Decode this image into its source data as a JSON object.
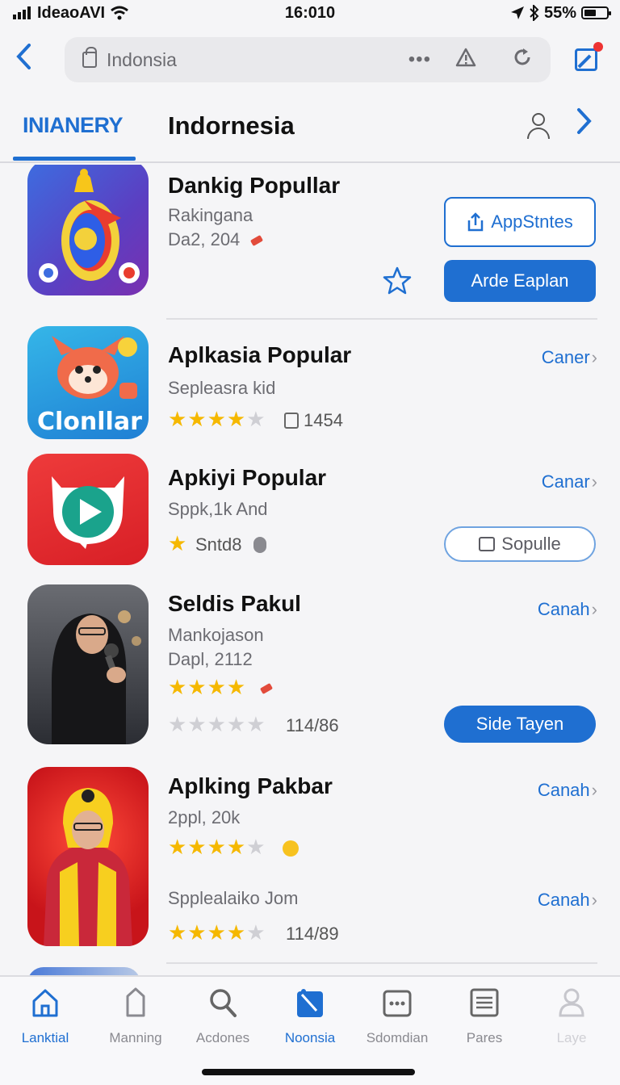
{
  "status_bar": {
    "carrier": "IdeaoAVI",
    "time": "16:010",
    "battery": "55%"
  },
  "url_bar": {
    "text": "Indonsia",
    "more_icon": "ellipsis-icon",
    "warning_icon": "warning-icon",
    "reload_icon": "reload-icon"
  },
  "header": {
    "active_tab": "INIANERY",
    "title": "Indornesia"
  },
  "apps": [
    {
      "title": "Dankig Popullar",
      "subtitle": "Rakingana",
      "date": "Da2, 204",
      "outline_button": "AppStntes",
      "solid_button": "Arde Eaplan"
    },
    {
      "title": "Aplkasia Popular",
      "subtitle": "Sepleasra kid",
      "rating_stars": 4,
      "count": "1454",
      "action": "Caner"
    },
    {
      "title": "Apkiyi Popular",
      "subtitle": "Sppk,1k And",
      "rating_stars": 1,
      "count": "Sntd8",
      "action": "Canar",
      "pill_button": "Sopulle"
    },
    {
      "title": "Seldis Pakul",
      "subtitle": "Mankojason",
      "date": "Dapl, 2112",
      "rating_stars": 4,
      "rating_stars_2": 0,
      "count": "114/86",
      "action": "Canah",
      "pill_button": "Side Tayen"
    },
    {
      "title": "Aplking Pakbar",
      "subtitle": "2ppl, 20k",
      "rating_stars": 4,
      "subtitle_2": "Spplealaiko Jom",
      "rating_stars_2": 4,
      "count": "114/89",
      "action": "Canah",
      "action_2": "Canah"
    }
  ],
  "app_tile_art": {
    "tile_2_text": "Clonllar"
  },
  "tab_bar": {
    "items": [
      {
        "label": "Lanktial",
        "active": true
      },
      {
        "label": "Manning",
        "active": false
      },
      {
        "label": "Acdones",
        "active": false
      },
      {
        "label": "Noonsia",
        "active": true
      },
      {
        "label": "Sdomdian",
        "active": false
      },
      {
        "label": "Pares",
        "active": false
      },
      {
        "label": "Laye",
        "active": false
      }
    ]
  },
  "colors": {
    "accent": "#1f6fd1",
    "star": "#f5b800",
    "star_off": "#cfcfd4"
  }
}
